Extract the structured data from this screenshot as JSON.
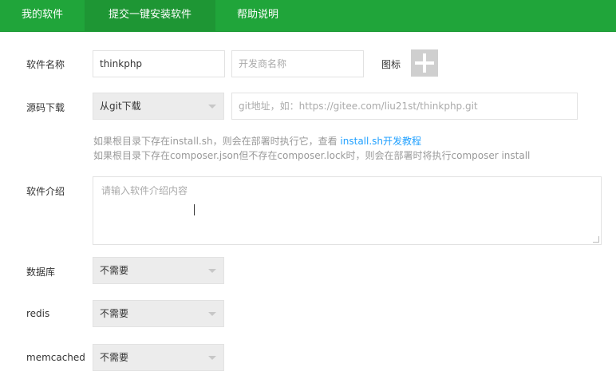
{
  "tabs": [
    {
      "label": "我的软件"
    },
    {
      "label": "提交一键安装软件",
      "active": true
    },
    {
      "label": "帮助说明"
    }
  ],
  "form": {
    "software_name": {
      "label": "软件名称",
      "value": "thinkphp",
      "vendor_placeholder": "开发商名称",
      "icon_label": "图标"
    },
    "source": {
      "label": "源码下载",
      "selected": "从git下载",
      "git_placeholder": "git地址，如：https://gitee.com/liu21st/thinkphp.git"
    },
    "tips": {
      "line1_prefix": "如果根目录下存在install.sh，则会在部署时执行它，查看",
      "line1_link": "install.sh开发教程",
      "line2": "如果根目录下存在composer.json但不存在composer.lock时，则会在部署时将执行composer install"
    },
    "intro": {
      "label": "软件介绍",
      "placeholder": "请输入软件介绍内容"
    },
    "database": {
      "label": "数据库",
      "selected": "不需要"
    },
    "redis": {
      "label": "redis",
      "selected": "不需要"
    },
    "memcached": {
      "label": "memcached",
      "selected": "不需要"
    }
  },
  "colors": {
    "accent": "#20a53a",
    "link": "#20a0ff"
  }
}
